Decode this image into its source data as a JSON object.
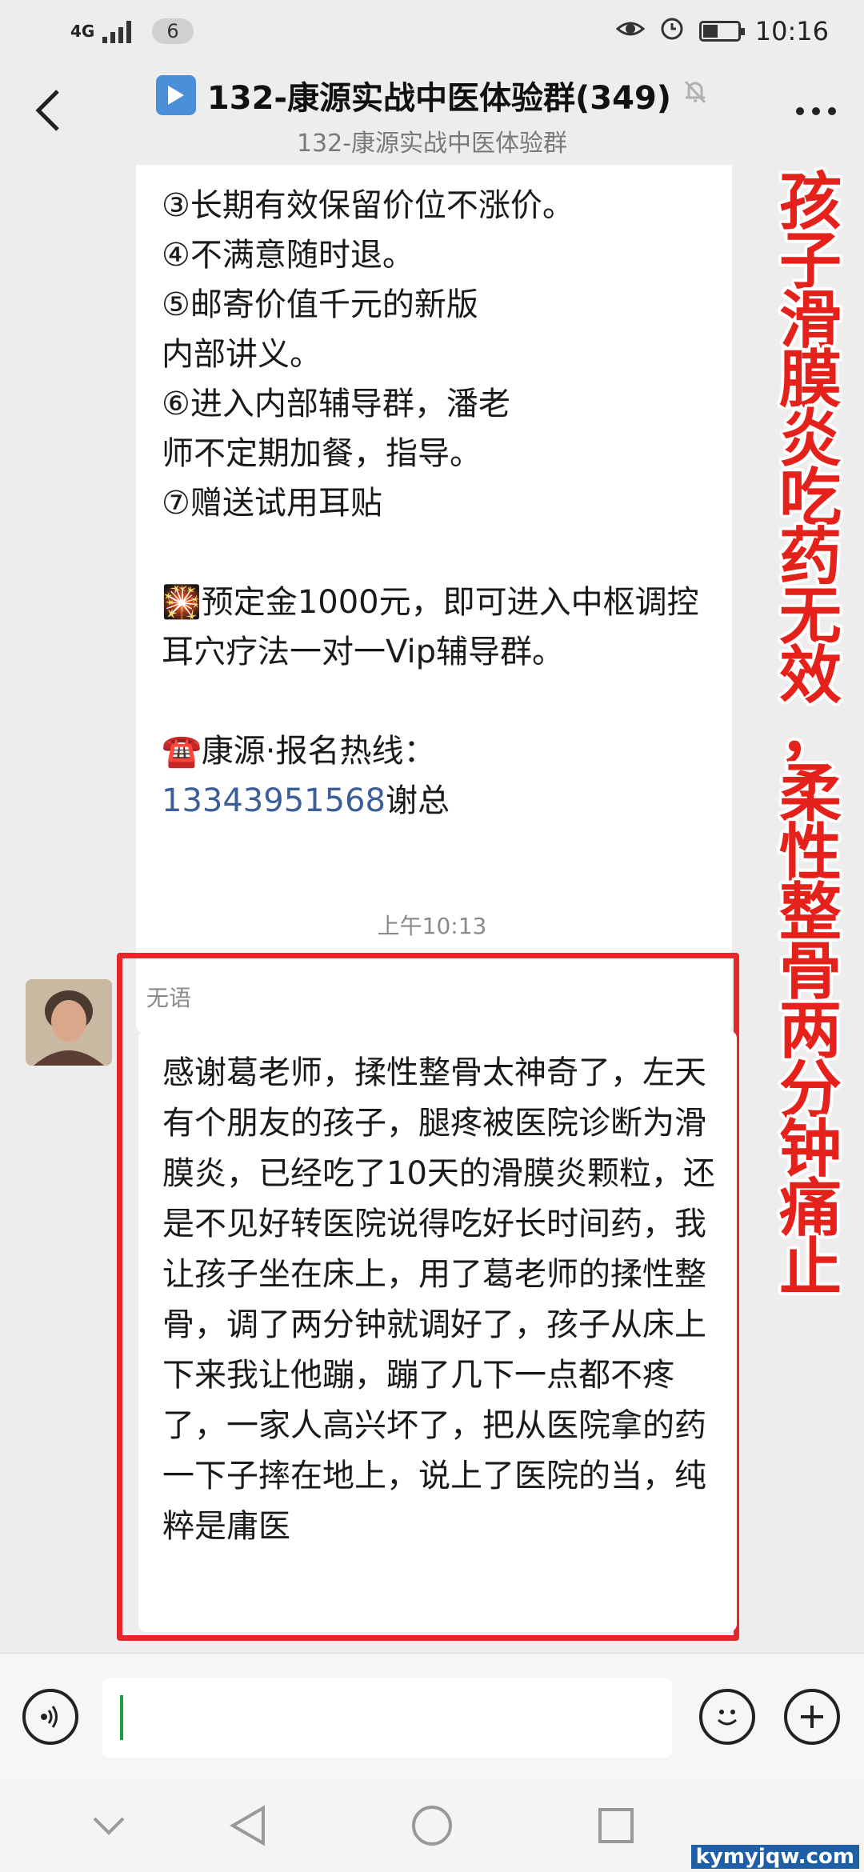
{
  "status_bar": {
    "network": "4G",
    "badge": "6",
    "time": "10:16",
    "icons": [
      "eye-icon",
      "alarm-icon",
      "battery-icon"
    ]
  },
  "header": {
    "title": "132-康源实战中医体验群(349)",
    "subtitle": "132-康源实战中医体验群",
    "back_icon": "chevron-left-icon",
    "more_icon": "more-dots-icon",
    "mute_icon": "bell-muted-icon"
  },
  "messages": {
    "first": {
      "lines": [
        "③长期有效保留价位不涨价。",
        "④不满意随时退。",
        "⑤邮寄价值千元的新版内部讲义。",
        "⑥进入内部辅导群，潘老师不定期加餐，指导。",
        "⑦赠送试用耳贴",
        "",
        "🎇预定金1000元，即可进入中枢调控耳穴疗法一对一Vip辅导群。",
        "",
        "☎️康源·报名热线："
      ],
      "phone": "13343951568",
      "phone_suffix": "谢总"
    },
    "timestamp": "上午10:13",
    "second": {
      "sender": "无语",
      "text": "感谢葛老师，揉性整骨太神奇了，左天有个朋友的孩子，腿疼被医院诊断为滑膜炎，已经吃了10天的滑膜炎颗粒，还是不见好转医院说得吃好长时间药，我让孩子坐在床上，用了葛老师的揉性整骨，调了两分钟就调好了，孩子从床上下来我让他蹦，蹦了几下一点都不疼了，一家人高兴坏了，把从医院拿的药一下子摔在地上，说上了医院的当，纯粹是庸医"
    }
  },
  "overlay": {
    "text": "孩子滑膜炎吃药无效，柔性整骨两分钟痛止",
    "color": "#e5211c"
  },
  "input_bar": {
    "voice_icon": "voice-icon",
    "emoji_icon": "emoji-icon",
    "plus_icon": "plus-icon",
    "value": ""
  },
  "nav_bar": {
    "icons": [
      "chevron-down-icon",
      "back-triangle-icon",
      "home-circle-icon",
      "recents-square-icon"
    ]
  },
  "watermark": "kymyjqw.com"
}
